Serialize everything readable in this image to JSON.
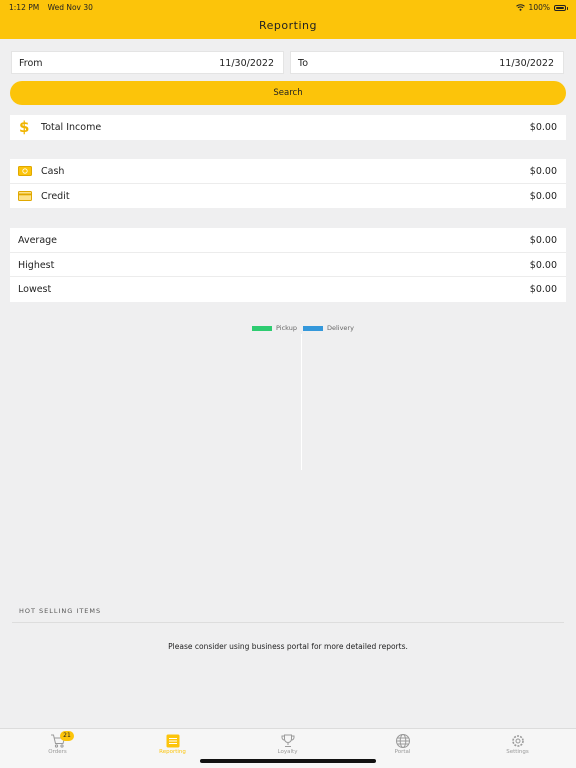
{
  "status": {
    "time": "1:12 PM",
    "date": "Wed Nov 30",
    "battery": "100%"
  },
  "header": {
    "title": "Reporting"
  },
  "filters": {
    "from_label": "From",
    "from_value": "11/30/2022",
    "to_label": "To",
    "to_value": "11/30/2022",
    "search_label": "Search"
  },
  "income": {
    "label": "Total Income",
    "value": "$0.00"
  },
  "payments": [
    {
      "label": "Cash",
      "value": "$0.00"
    },
    {
      "label": "Credit",
      "value": "$0.00"
    }
  ],
  "stats": [
    {
      "label": "Average",
      "value": "$0.00"
    },
    {
      "label": "Highest",
      "value": "$0.00"
    },
    {
      "label": "Lowest",
      "value": "$0.00"
    }
  ],
  "chart_legend": [
    {
      "name": "Pickup",
      "color": "#2ecc71"
    },
    {
      "name": "Delivery",
      "color": "#3498db"
    }
  ],
  "hot_selling": {
    "title": "HOT SELLING ITEMS",
    "note": "Please consider using business portal for more detailed reports."
  },
  "tabs": [
    {
      "label": "Orders",
      "icon": "cart-icon",
      "badge": "21"
    },
    {
      "label": "Reporting",
      "icon": "report-icon"
    },
    {
      "label": "Loyalty",
      "icon": "trophy-icon"
    },
    {
      "label": "Portal",
      "icon": "globe-icon"
    },
    {
      "label": "Settings",
      "icon": "gear-icon"
    }
  ],
  "colors": {
    "accent": "#fcc40a",
    "background": "#efeff0"
  }
}
